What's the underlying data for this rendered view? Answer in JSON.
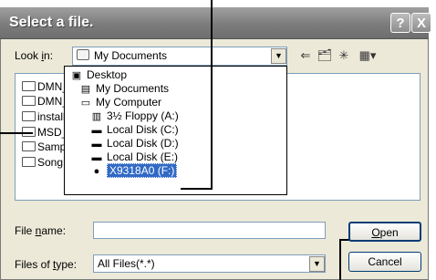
{
  "window": {
    "title": "Select a file.",
    "help_label": "?",
    "close_label": "X"
  },
  "lookin": {
    "label_pre": "Look ",
    "label_key": "i",
    "label_post": "n:",
    "value": "My Documents"
  },
  "toolbar": {
    "back_icon": "back-arrow-icon",
    "up_icon": "up-folder-icon",
    "newfolder_icon": "new-folder-icon",
    "views_icon": "views-menu-icon"
  },
  "files": [
    {
      "name": "DMN_"
    },
    {
      "name": "DMN_"
    },
    {
      "name": "install"
    },
    {
      "name": "MSD_"
    },
    {
      "name": "Sampl"
    },
    {
      "name": "SongB"
    }
  ],
  "dropdown": [
    {
      "label": "Desktop",
      "icon": "desktop-icon",
      "indent": 0
    },
    {
      "label": "My Documents",
      "icon": "documents-folder-icon",
      "indent": 1
    },
    {
      "label": "My Computer",
      "icon": "computer-icon",
      "indent": 1
    },
    {
      "label": "3½ Floppy (A:)",
      "icon": "floppy-drive-icon",
      "indent": 2
    },
    {
      "label": "Local Disk (C:)",
      "icon": "hard-disk-icon",
      "indent": 2
    },
    {
      "label": "Local Disk (D:)",
      "icon": "hard-disk-icon",
      "indent": 2
    },
    {
      "label": "Local Disk (E:)",
      "icon": "hard-disk-icon",
      "indent": 2
    },
    {
      "label": "X9318A0 (F:)",
      "icon": "removable-drive-icon",
      "indent": 2,
      "selected": true
    }
  ],
  "filename": {
    "label_pre": "File ",
    "label_key": "n",
    "label_post": "ame:",
    "value": ""
  },
  "filetype": {
    "label_pre": "Files of ",
    "label_key": "t",
    "label_post": "ype:",
    "value": "All Files(*.*)"
  },
  "buttons": {
    "open_key": "O",
    "open_rest": "pen",
    "cancel": "Cancel"
  }
}
